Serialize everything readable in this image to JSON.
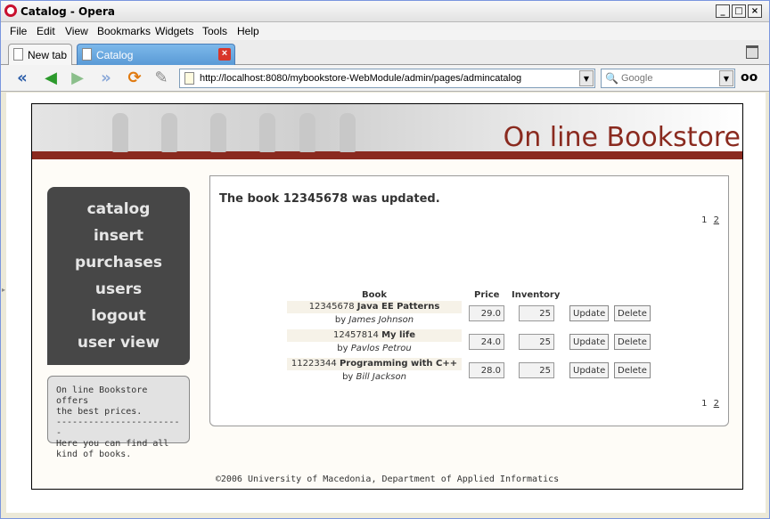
{
  "window": {
    "title": "Catalog - Opera",
    "minimize": "_",
    "maximize": "□",
    "close": "×"
  },
  "menu": [
    "File",
    "Edit",
    "View",
    "Bookmarks",
    "Widgets",
    "Tools",
    "Help"
  ],
  "tabs": [
    {
      "label": "New tab",
      "active": false
    },
    {
      "label": "Catalog",
      "active": true
    }
  ],
  "address": {
    "url": "http://localhost:8080/mybookstore-WebModule/admin/pages/admincatalog"
  },
  "search": {
    "placeholder": "Google"
  },
  "site": {
    "title": "On line Bookstore",
    "nav": [
      "catalog",
      "insert",
      "purchases",
      "users",
      "logout",
      "user view"
    ],
    "info": [
      "On line Bookstore offers",
      "the best prices.",
      "------------------------",
      "Here you can find all",
      "kind of books."
    ],
    "footer": "©2006 University of Macedonia, Department of Applied Informatics"
  },
  "content": {
    "message": "The book 12345678 was updated.",
    "pager": {
      "page1": "1",
      "page2": "2"
    },
    "headers": {
      "book": "Book",
      "price": "Price",
      "inventory": "Inventory"
    },
    "update_label": "Update",
    "delete_label": "Delete",
    "books": [
      {
        "id": "12345678",
        "title": "Java EE Patterns",
        "by": "by",
        "author": "James Johnson",
        "price": "29.0",
        "inventory": "25"
      },
      {
        "id": "12457814",
        "title": "My life",
        "by": "by",
        "author": "Pavlos Petrou",
        "price": "24.0",
        "inventory": "25"
      },
      {
        "id": "11223344",
        "title": "Programming with C++",
        "by": "by",
        "author": "Bill Jackson",
        "price": "28.0",
        "inventory": "25"
      }
    ]
  },
  "colors": {
    "brand": "#8a2a1f",
    "nav_bg": "#474747",
    "tab_active": "#5a9ad6"
  }
}
